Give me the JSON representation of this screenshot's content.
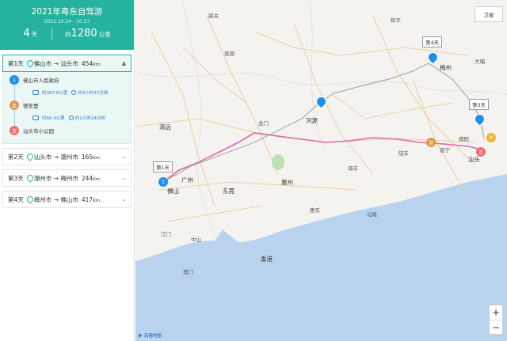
{
  "trip": {
    "title": "2021年粤东自驾游",
    "dates": "2021.10.24 - 10.27",
    "days": "4",
    "days_unit": "天",
    "distance_prefix": "约",
    "distance": "1280",
    "distance_unit": "公里"
  },
  "day1": {
    "label": "第1天",
    "from": "佛山市",
    "arrow": "→",
    "to": "汕头市",
    "km": "454",
    "km_unit": "Km"
  },
  "stops": [
    {
      "badge": "1",
      "name": "佛山市人民政府",
      "color": "#1e90e8"
    },
    {
      "badge": "京",
      "name": "德安里",
      "color": "#e0964a"
    },
    {
      "badge": "京",
      "name": "汕头市小公园",
      "color": "#f06c6c"
    }
  ],
  "legs": [
    {
      "dist": "约387.6公里",
      "time": "约4小时37分钟"
    },
    {
      "dist": "约66.4公里",
      "time": "约1小时24分钟"
    }
  ],
  "days": [
    {
      "label": "第2天",
      "from": "汕头市",
      "arrow": "→",
      "to": "潮州市",
      "km": "165",
      "km_unit": "Km"
    },
    {
      "label": "第3天",
      "from": "潮州市",
      "arrow": "→",
      "to": "梅州市",
      "km": "244",
      "km_unit": "Km"
    },
    {
      "label": "第4天",
      "from": "梅州市",
      "arrow": "→",
      "to": "佛山市",
      "km": "417",
      "km_unit": "Km"
    }
  ],
  "map": {
    "satellite": "卫星",
    "zoom_in": "+",
    "zoom_out": "−",
    "logo": "高德地图",
    "day_tags": [
      "第1天",
      "第3天",
      "第4天"
    ],
    "labels": [
      "韶关",
      "和平",
      "翁源",
      "河源",
      "龙门",
      "清远",
      "广州",
      "佛山",
      "东莞",
      "惠州",
      "中山",
      "江门",
      "澳门",
      "香港",
      "汕尾",
      "揭阳",
      "普宁",
      "梅州",
      "大埔",
      "汕头",
      "陆丰",
      "海丰",
      "惠东"
    ]
  }
}
